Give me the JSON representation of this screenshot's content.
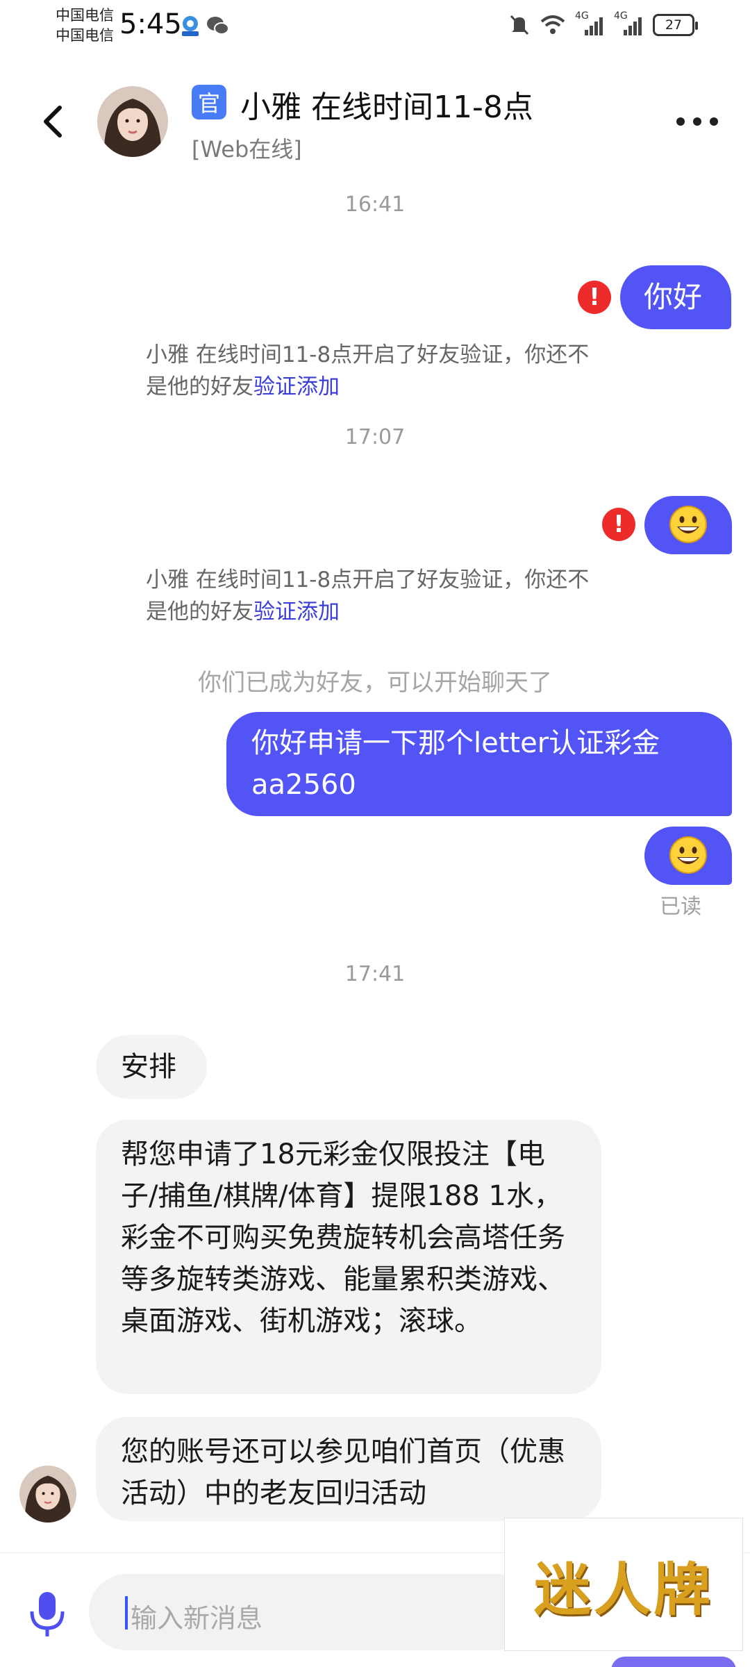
{
  "status_bar": {
    "carrier1": "中国电信",
    "carrier2": "中国电信",
    "time": "5:45",
    "network1": "4G",
    "network2": "4G",
    "battery": "27"
  },
  "header": {
    "badge": "官",
    "title": "小雅 在线时间11-8点",
    "subtitle": "[Web在线]"
  },
  "messages": {
    "time1": "16:41",
    "out1": "你好",
    "notice1_text": "小雅 在线时间11-8点开启了好友验证，你还不是他的好友",
    "notice1_link": "验证添加",
    "time2": "17:07",
    "notice2_text": "小雅 在线时间11-8点开启了好友验证，你还不是他的好友",
    "notice2_link": "验证添加",
    "system": "你们已成为好友，可以开始聊天了",
    "out2": "你好申请一下那个letter认证彩金aa2560",
    "read_status": "已读",
    "time3": "17:41",
    "in1": "安排",
    "in2": "帮您申请了18元彩金仅限投注【电子/捕鱼/棋牌/体育】提限188 1水，彩金不可购买免费旋转机会高塔任务等多旋转类游戏、能量累积类游戏、桌面游戏、街机游戏；滚球。",
    "in3": "您的账号还可以参见咱们首页（优惠活动）中的老友回归活动"
  },
  "input": {
    "placeholder": "输入新消息"
  },
  "watermark": "迷人牌",
  "colors": {
    "outgoing_bubble": "#5254f5",
    "incoming_bubble": "#f3f3f3",
    "link": "#3b3fd8",
    "error": "#ee2b2b"
  }
}
